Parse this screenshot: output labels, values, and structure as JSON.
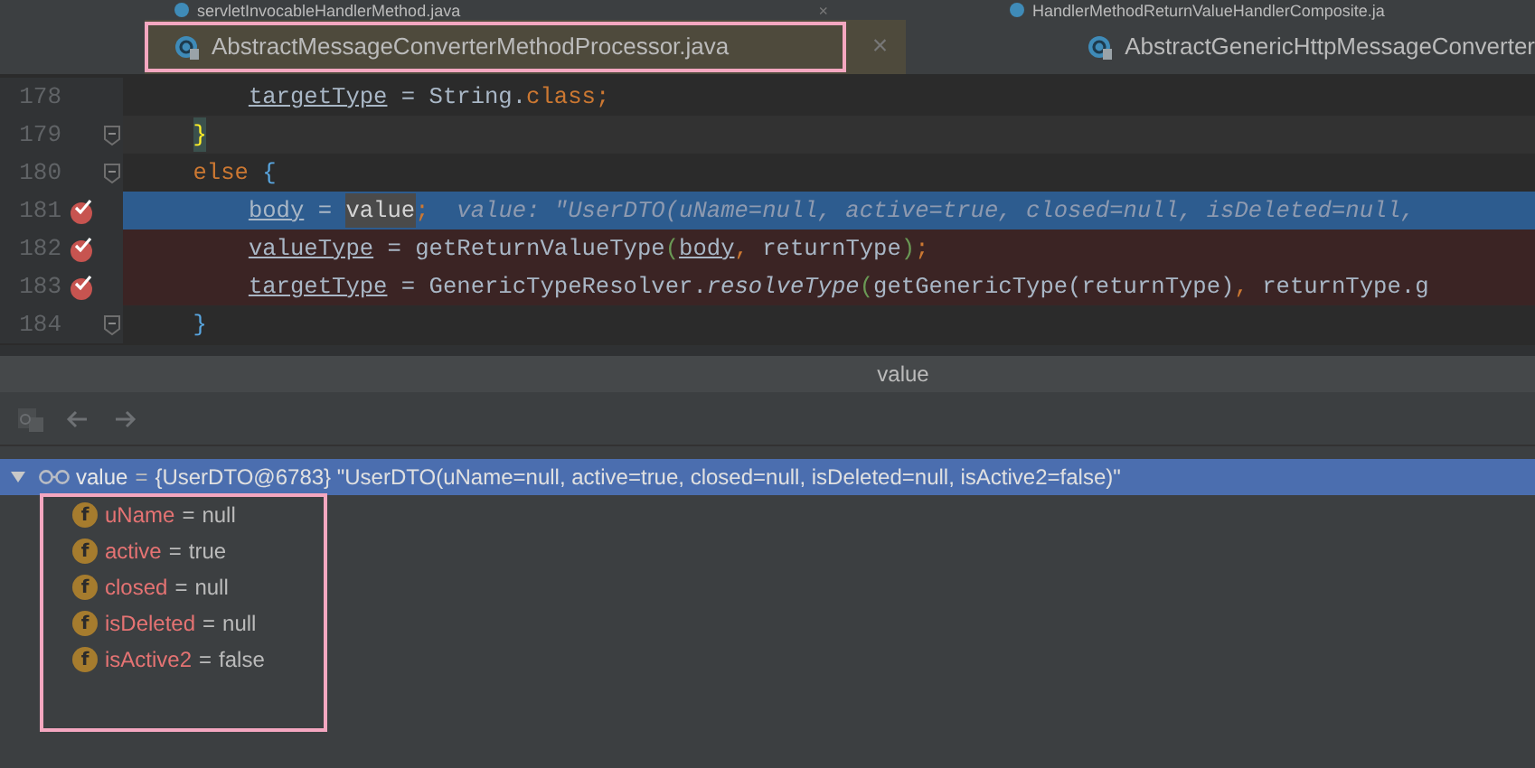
{
  "top_tabs": [
    {
      "label": "servletInvocableHandlerMethod.java",
      "close": "×"
    },
    {
      "label": "HandlerMethodReturnValueHandlerComposite.ja"
    }
  ],
  "editor_tabs": [
    {
      "label": "AbstractMessageConverterMethodProcessor.java",
      "selected": true,
      "highlight_frame": true,
      "close": "×"
    },
    {
      "label": "AbstractGenericHttpMessageConverter",
      "selected": false,
      "highlight_frame": false
    }
  ],
  "editor": {
    "lines": [
      {
        "number": "178",
        "kind": "plain",
        "breakpoint": false,
        "fold": false,
        "tokens": [
          {
            "kind": "var",
            "text": "        targetType"
          },
          {
            "kind": "text",
            "text": " = String."
          },
          {
            "kind": "kw",
            "text": "class"
          },
          {
            "kind": "punct",
            "text": ";"
          }
        ]
      },
      {
        "number": "179",
        "kind": "current",
        "breakpoint": false,
        "fold": true,
        "tokens": [
          {
            "kind": "match",
            "text": "    }"
          }
        ]
      },
      {
        "number": "180",
        "kind": "plain",
        "breakpoint": false,
        "fold": true,
        "tokens": [
          {
            "kind": "kw",
            "text": "    else"
          },
          {
            "kind": "brace",
            "text": " {"
          }
        ]
      },
      {
        "number": "181",
        "kind": "execution",
        "breakpoint": true,
        "fold": false,
        "tokens": [
          {
            "kind": "var",
            "text": "        body"
          },
          {
            "kind": "text",
            "text": " = "
          },
          {
            "kind": "usage",
            "text": "value"
          },
          {
            "kind": "punct",
            "text": ";"
          },
          {
            "kind": "hint",
            "text": "  value: \"UserDTO(uName=null, active=true, closed=null, isDeleted=null,"
          }
        ]
      },
      {
        "number": "182",
        "kind": "breakpoint",
        "breakpoint": true,
        "fold": false,
        "tokens": [
          {
            "kind": "var",
            "text": "        valueType"
          },
          {
            "kind": "text",
            "text": " = getReturnValueType"
          },
          {
            "kind": "paren",
            "text": "("
          },
          {
            "kind": "var",
            "text": "body"
          },
          {
            "kind": "punct",
            "text": ","
          },
          {
            "kind": "text",
            "text": " returnType"
          },
          {
            "kind": "paren",
            "text": ")"
          },
          {
            "kind": "punct",
            "text": ";"
          }
        ]
      },
      {
        "number": "183",
        "kind": "breakpoint",
        "breakpoint": true,
        "fold": false,
        "tokens": [
          {
            "kind": "var",
            "text": "        targetType"
          },
          {
            "kind": "text",
            "text": " = GenericTypeResolver."
          },
          {
            "kind": "static",
            "text": "resolveType"
          },
          {
            "kind": "paren",
            "text": "("
          },
          {
            "kind": "text",
            "text": "getGenericType(returnType)"
          },
          {
            "kind": "punct",
            "text": ","
          },
          {
            "kind": "text",
            "text": " returnType.g"
          }
        ]
      },
      {
        "number": "184",
        "kind": "plain",
        "breakpoint": false,
        "fold": true,
        "tokens": [
          {
            "kind": "brace",
            "text": "    }"
          }
        ]
      }
    ]
  },
  "panel": {
    "title": "value",
    "toolbar": [
      {
        "kind": "watch"
      },
      {
        "kind": "back"
      },
      {
        "kind": "forward"
      }
    ],
    "tree": [
      {
        "kind": "watch",
        "name": "value",
        "operator": "=",
        "value": "{UserDTO@6783} \"UserDTO(uName=null, active=true, closed=null, isDeleted=null, isActive2=false)\"",
        "expanded": true,
        "selected": true,
        "children_framed": true,
        "children": [
          {
            "kind": "field",
            "icon": "f",
            "name": "uName",
            "operator": "=",
            "value": "null",
            "selected": false
          },
          {
            "kind": "field",
            "icon": "f",
            "name": "active",
            "operator": "=",
            "value": "true",
            "selected": false
          },
          {
            "kind": "field",
            "icon": "f",
            "name": "closed",
            "operator": "=",
            "value": "null",
            "selected": false
          },
          {
            "kind": "field",
            "icon": "f",
            "name": "isDeleted",
            "operator": "=",
            "value": "null",
            "selected": false
          },
          {
            "kind": "field",
            "icon": "f",
            "name": "isActive2",
            "operator": "=",
            "value": "false",
            "selected": false
          }
        ]
      }
    ]
  }
}
